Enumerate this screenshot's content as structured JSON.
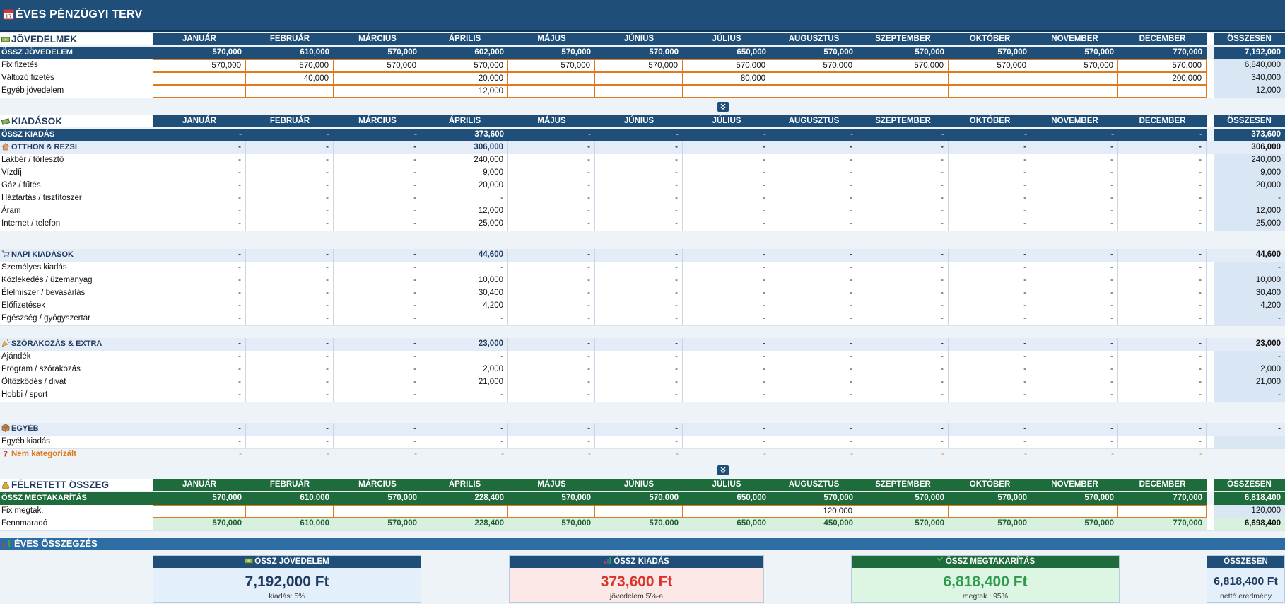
{
  "title": "ÉVES PÉNZÜGYI TERV",
  "months": [
    "JANUÁR",
    "FEBRUÁR",
    "MÁRCIUS",
    "ÁPRILIS",
    "MÁJUS",
    "JÚNIUS",
    "JÚLIUS",
    "AUGUSZTUS",
    "SZEPTEMBER",
    "OKTÓBER",
    "NOVEMBER",
    "DECEMBER"
  ],
  "total_header": "ÖSSZESEN",
  "income": {
    "section": "JÖVEDELMEK",
    "sum_label": "ÖSSZ JÖVEDELEM",
    "sum_values": [
      "570,000",
      "610,000",
      "570,000",
      "602,000",
      "570,000",
      "570,000",
      "650,000",
      "570,000",
      "570,000",
      "570,000",
      "570,000",
      "770,000"
    ],
    "sum_total": "7,192,000",
    "rows": [
      {
        "label": "Fix fizetés",
        "values": [
          "570,000",
          "570,000",
          "570,000",
          "570,000",
          "570,000",
          "570,000",
          "570,000",
          "570,000",
          "570,000",
          "570,000",
          "570,000",
          "570,000"
        ],
        "total": "6,840,000"
      },
      {
        "label": "Változó fizetés",
        "values": [
          "",
          "40,000",
          "",
          "20,000",
          "",
          "",
          "80,000",
          "",
          "",
          "",
          "",
          "200,000"
        ],
        "total": "340,000"
      },
      {
        "label": "Egyéb jövedelem",
        "values": [
          "",
          "",
          "",
          "12,000",
          "",
          "",
          "",
          "",
          "",
          "",
          "",
          ""
        ],
        "total": "12,000"
      }
    ]
  },
  "expenses": {
    "section": "KIADÁSOK",
    "sum_label": "ÖSSZ KIADÁS",
    "sum_values": [
      "-",
      "-",
      "-",
      "373,600",
      "-",
      "-",
      "-",
      "-",
      "-",
      "-",
      "-",
      "-"
    ],
    "sum_total": "373,600",
    "groups": [
      {
        "label": "OTTHON & REZSI",
        "values": [
          "-",
          "-",
          "-",
          "306,000",
          "-",
          "-",
          "-",
          "-",
          "-",
          "-",
          "-",
          "-"
        ],
        "total": "306,000",
        "rows": [
          {
            "label": "Lakbér / törlesztő",
            "values": [
              "-",
              "-",
              "-",
              "240,000",
              "-",
              "-",
              "-",
              "-",
              "-",
              "-",
              "-",
              "-"
            ],
            "total": "240,000"
          },
          {
            "label": "Vízdíj",
            "values": [
              "-",
              "-",
              "-",
              "9,000",
              "-",
              "-",
              "-",
              "-",
              "-",
              "-",
              "-",
              "-"
            ],
            "total": "9,000"
          },
          {
            "label": "Gáz / fűtés",
            "values": [
              "-",
              "-",
              "-",
              "20,000",
              "-",
              "-",
              "-",
              "-",
              "-",
              "-",
              "-",
              "-"
            ],
            "total": "20,000"
          },
          {
            "label": "Háztartás / tisztítószer",
            "values": [
              "-",
              "-",
              "-",
              "-",
              "-",
              "-",
              "-",
              "-",
              "-",
              "-",
              "-",
              "-"
            ],
            "total": "-"
          },
          {
            "label": "Áram",
            "values": [
              "-",
              "-",
              "-",
              "12,000",
              "-",
              "-",
              "-",
              "-",
              "-",
              "-",
              "-",
              "-"
            ],
            "total": "12,000"
          },
          {
            "label": "Internet / telefon",
            "values": [
              "-",
              "-",
              "-",
              "25,000",
              "-",
              "-",
              "-",
              "-",
              "-",
              "-",
              "-",
              "-"
            ],
            "total": "25,000"
          }
        ]
      },
      {
        "label": "NAPI KIADÁSOK",
        "values": [
          "-",
          "-",
          "-",
          "44,600",
          "-",
          "-",
          "-",
          "-",
          "-",
          "-",
          "-",
          "-"
        ],
        "total": "44,600",
        "rows": [
          {
            "label": "Személyes kiadás",
            "values": [
              "-",
              "-",
              "-",
              "-",
              "-",
              "-",
              "-",
              "-",
              "-",
              "-",
              "-",
              "-"
            ],
            "total": "-"
          },
          {
            "label": "Közlekedés / üzemanyag",
            "values": [
              "-",
              "-",
              "-",
              "10,000",
              "-",
              "-",
              "-",
              "-",
              "-",
              "-",
              "-",
              "-"
            ],
            "total": "10,000"
          },
          {
            "label": "Élelmiszer / bevásárlás",
            "values": [
              "-",
              "-",
              "-",
              "30,400",
              "-",
              "-",
              "-",
              "-",
              "-",
              "-",
              "-",
              "-"
            ],
            "total": "30,400"
          },
          {
            "label": "Előfizetések",
            "values": [
              "-",
              "-",
              "-",
              "4,200",
              "-",
              "-",
              "-",
              "-",
              "-",
              "-",
              "-",
              "-"
            ],
            "total": "4,200"
          },
          {
            "label": "Egészség / gyógyszertár",
            "values": [
              "-",
              "-",
              "-",
              "-",
              "-",
              "-",
              "-",
              "-",
              "-",
              "-",
              "-",
              "-"
            ],
            "total": "-"
          }
        ]
      },
      {
        "label": "SZÓRAKOZÁS & EXTRA",
        "values": [
          "-",
          "-",
          "-",
          "23,000",
          "-",
          "-",
          "-",
          "-",
          "-",
          "-",
          "-",
          "-"
        ],
        "total": "23,000",
        "rows": [
          {
            "label": "Ajándék",
            "values": [
              "-",
              "-",
              "-",
              "-",
              "-",
              "-",
              "-",
              "-",
              "-",
              "-",
              "-",
              "-"
            ],
            "total": "-"
          },
          {
            "label": "Program / szórakozás",
            "values": [
              "-",
              "-",
              "-",
              "2,000",
              "-",
              "-",
              "-",
              "-",
              "-",
              "-",
              "-",
              "-"
            ],
            "total": "2,000"
          },
          {
            "label": "Öltözködés / divat",
            "values": [
              "-",
              "-",
              "-",
              "21,000",
              "-",
              "-",
              "-",
              "-",
              "-",
              "-",
              "-",
              "-"
            ],
            "total": "21,000"
          },
          {
            "label": "Hobbi / sport",
            "values": [
              "-",
              "-",
              "-",
              "-",
              "-",
              "-",
              "-",
              "-",
              "-",
              "-",
              "-",
              "-"
            ],
            "total": "-"
          }
        ]
      },
      {
        "label": "EGYÉB",
        "values": [
          "-",
          "-",
          "-",
          "-",
          "-",
          "-",
          "-",
          "-",
          "-",
          "-",
          "-",
          "-"
        ],
        "total": "-",
        "rows": [
          {
            "label": "Egyéb kiadás",
            "values": [
              "-",
              "-",
              "-",
              "-",
              "-",
              "-",
              "-",
              "-",
              "-",
              "-",
              "-",
              "-"
            ],
            "total": ""
          }
        ]
      }
    ],
    "uncat": {
      "label": "Nem kategorizált",
      "values": [
        "-",
        "-",
        "-",
        "-",
        "-",
        "-",
        "-",
        "-",
        "-",
        "-",
        "-",
        "-"
      ],
      "total": ""
    }
  },
  "savings": {
    "section": "FÉLRETETT ÖSSZEG",
    "sum_label": "ÖSSZ MEGTAKARÍTÁS",
    "sum_values": [
      "570,000",
      "610,000",
      "570,000",
      "228,400",
      "570,000",
      "570,000",
      "650,000",
      "570,000",
      "570,000",
      "570,000",
      "570,000",
      "770,000"
    ],
    "sum_total": "6,818,400",
    "fix": {
      "label": "Fix megtak.",
      "values": [
        "",
        "",
        "",
        "",
        "",
        "",
        "",
        "120,000",
        "",
        "",
        "",
        ""
      ],
      "total": "120,000"
    },
    "rest": {
      "label": "Fennmaradó",
      "values": [
        "570,000",
        "610,000",
        "570,000",
        "228,400",
        "570,000",
        "570,000",
        "650,000",
        "450,000",
        "570,000",
        "570,000",
        "570,000",
        "770,000"
      ],
      "total": "6,698,400"
    }
  },
  "summary": {
    "section": "ÉVES ÖSSZEGZÉS",
    "cards": [
      {
        "title": "ÖSSZ JÖVEDELEM",
        "value": "7,192,000 Ft",
        "sub": "kiadás: 5%"
      },
      {
        "title": "ÖSSZ KIADÁS",
        "value": "373,600 Ft",
        "sub": "jövedelem 5%-a"
      },
      {
        "title": "ÖSSZ MEGTAKARÍTÁS",
        "value": "6,818,400 Ft",
        "sub": "megtak.: 95%"
      },
      {
        "title": "ÖSSZESEN",
        "value": "6,818,400 Ft",
        "sub": "nettó eredmény"
      }
    ]
  },
  "colors": {
    "navy": "#1f4e79",
    "green": "#1e6b3c",
    "red": "#d9342b",
    "orange": "#e07b1c",
    "totalbg": "#d9e7f5"
  }
}
